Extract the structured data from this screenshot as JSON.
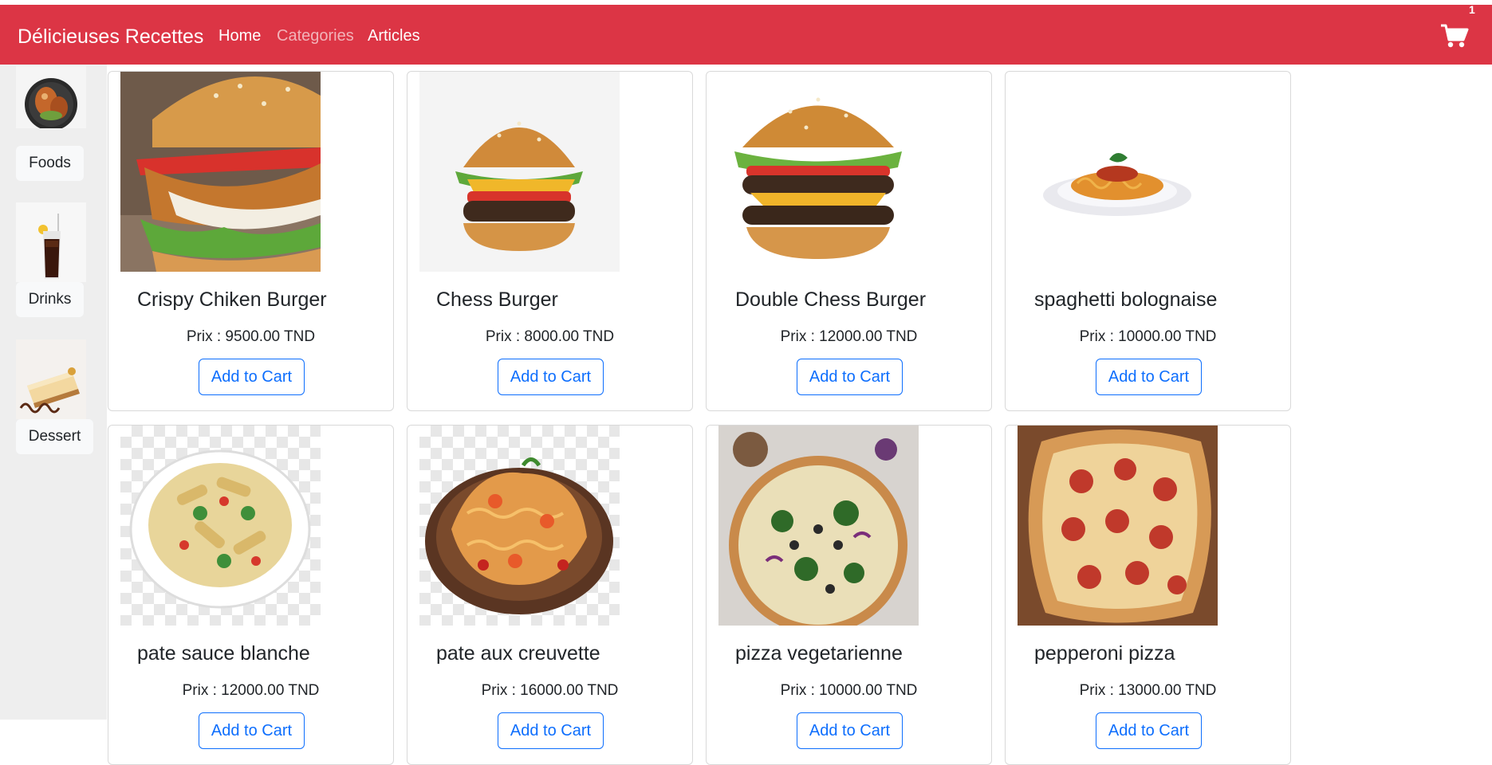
{
  "navbar": {
    "brand": "Délicieuses Recettes",
    "links": [
      "Home",
      "Categories",
      "Articles"
    ],
    "cart_count": "1",
    "background": "#dc3545"
  },
  "sidebar": {
    "categories": [
      {
        "label": "Foods",
        "icon": "food-plate-image"
      },
      {
        "label": "Drinks",
        "icon": "cola-glass-image"
      },
      {
        "label": "Dessert",
        "icon": "cheesecake-image"
      }
    ]
  },
  "products": [
    {
      "name": "Crispy Chiken Burger",
      "price": "Prix : 9500.00 TND",
      "button": "Add to Cart",
      "image": "crispy-chicken-burger-image"
    },
    {
      "name": "Chess Burger",
      "price": "Prix : 8000.00 TND",
      "button": "Add to Cart",
      "image": "cheese-burger-image"
    },
    {
      "name": "Double Chess Burger",
      "price": "Prix : 12000.00 TND",
      "button": "Add to Cart",
      "image": "double-cheese-burger-image"
    },
    {
      "name": "spaghetti bolognaise",
      "price": "Prix : 10000.00 TND",
      "button": "Add to Cart",
      "image": "spaghetti-image"
    },
    {
      "name": "pate sauce blanche",
      "price": "Prix : 12000.00 TND",
      "button": "Add to Cart",
      "image": "penne-white-sauce-image"
    },
    {
      "name": "pate aux creuvette",
      "price": "Prix : 16000.00 TND",
      "button": "Add to Cart",
      "image": "shrimp-pasta-image"
    },
    {
      "name": "pizza vegetarienne",
      "price": "Prix : 10000.00 TND",
      "button": "Add to Cart",
      "image": "veggie-pizza-image"
    },
    {
      "name": "pepperoni pizza",
      "price": "Prix : 13000.00 TND",
      "button": "Add to Cart",
      "image": "pepperoni-pizza-image"
    }
  ],
  "colors": {
    "accent": "#dc3545",
    "button_outline": "#0d6efd",
    "sidebar_bg": "#eeeeee"
  }
}
